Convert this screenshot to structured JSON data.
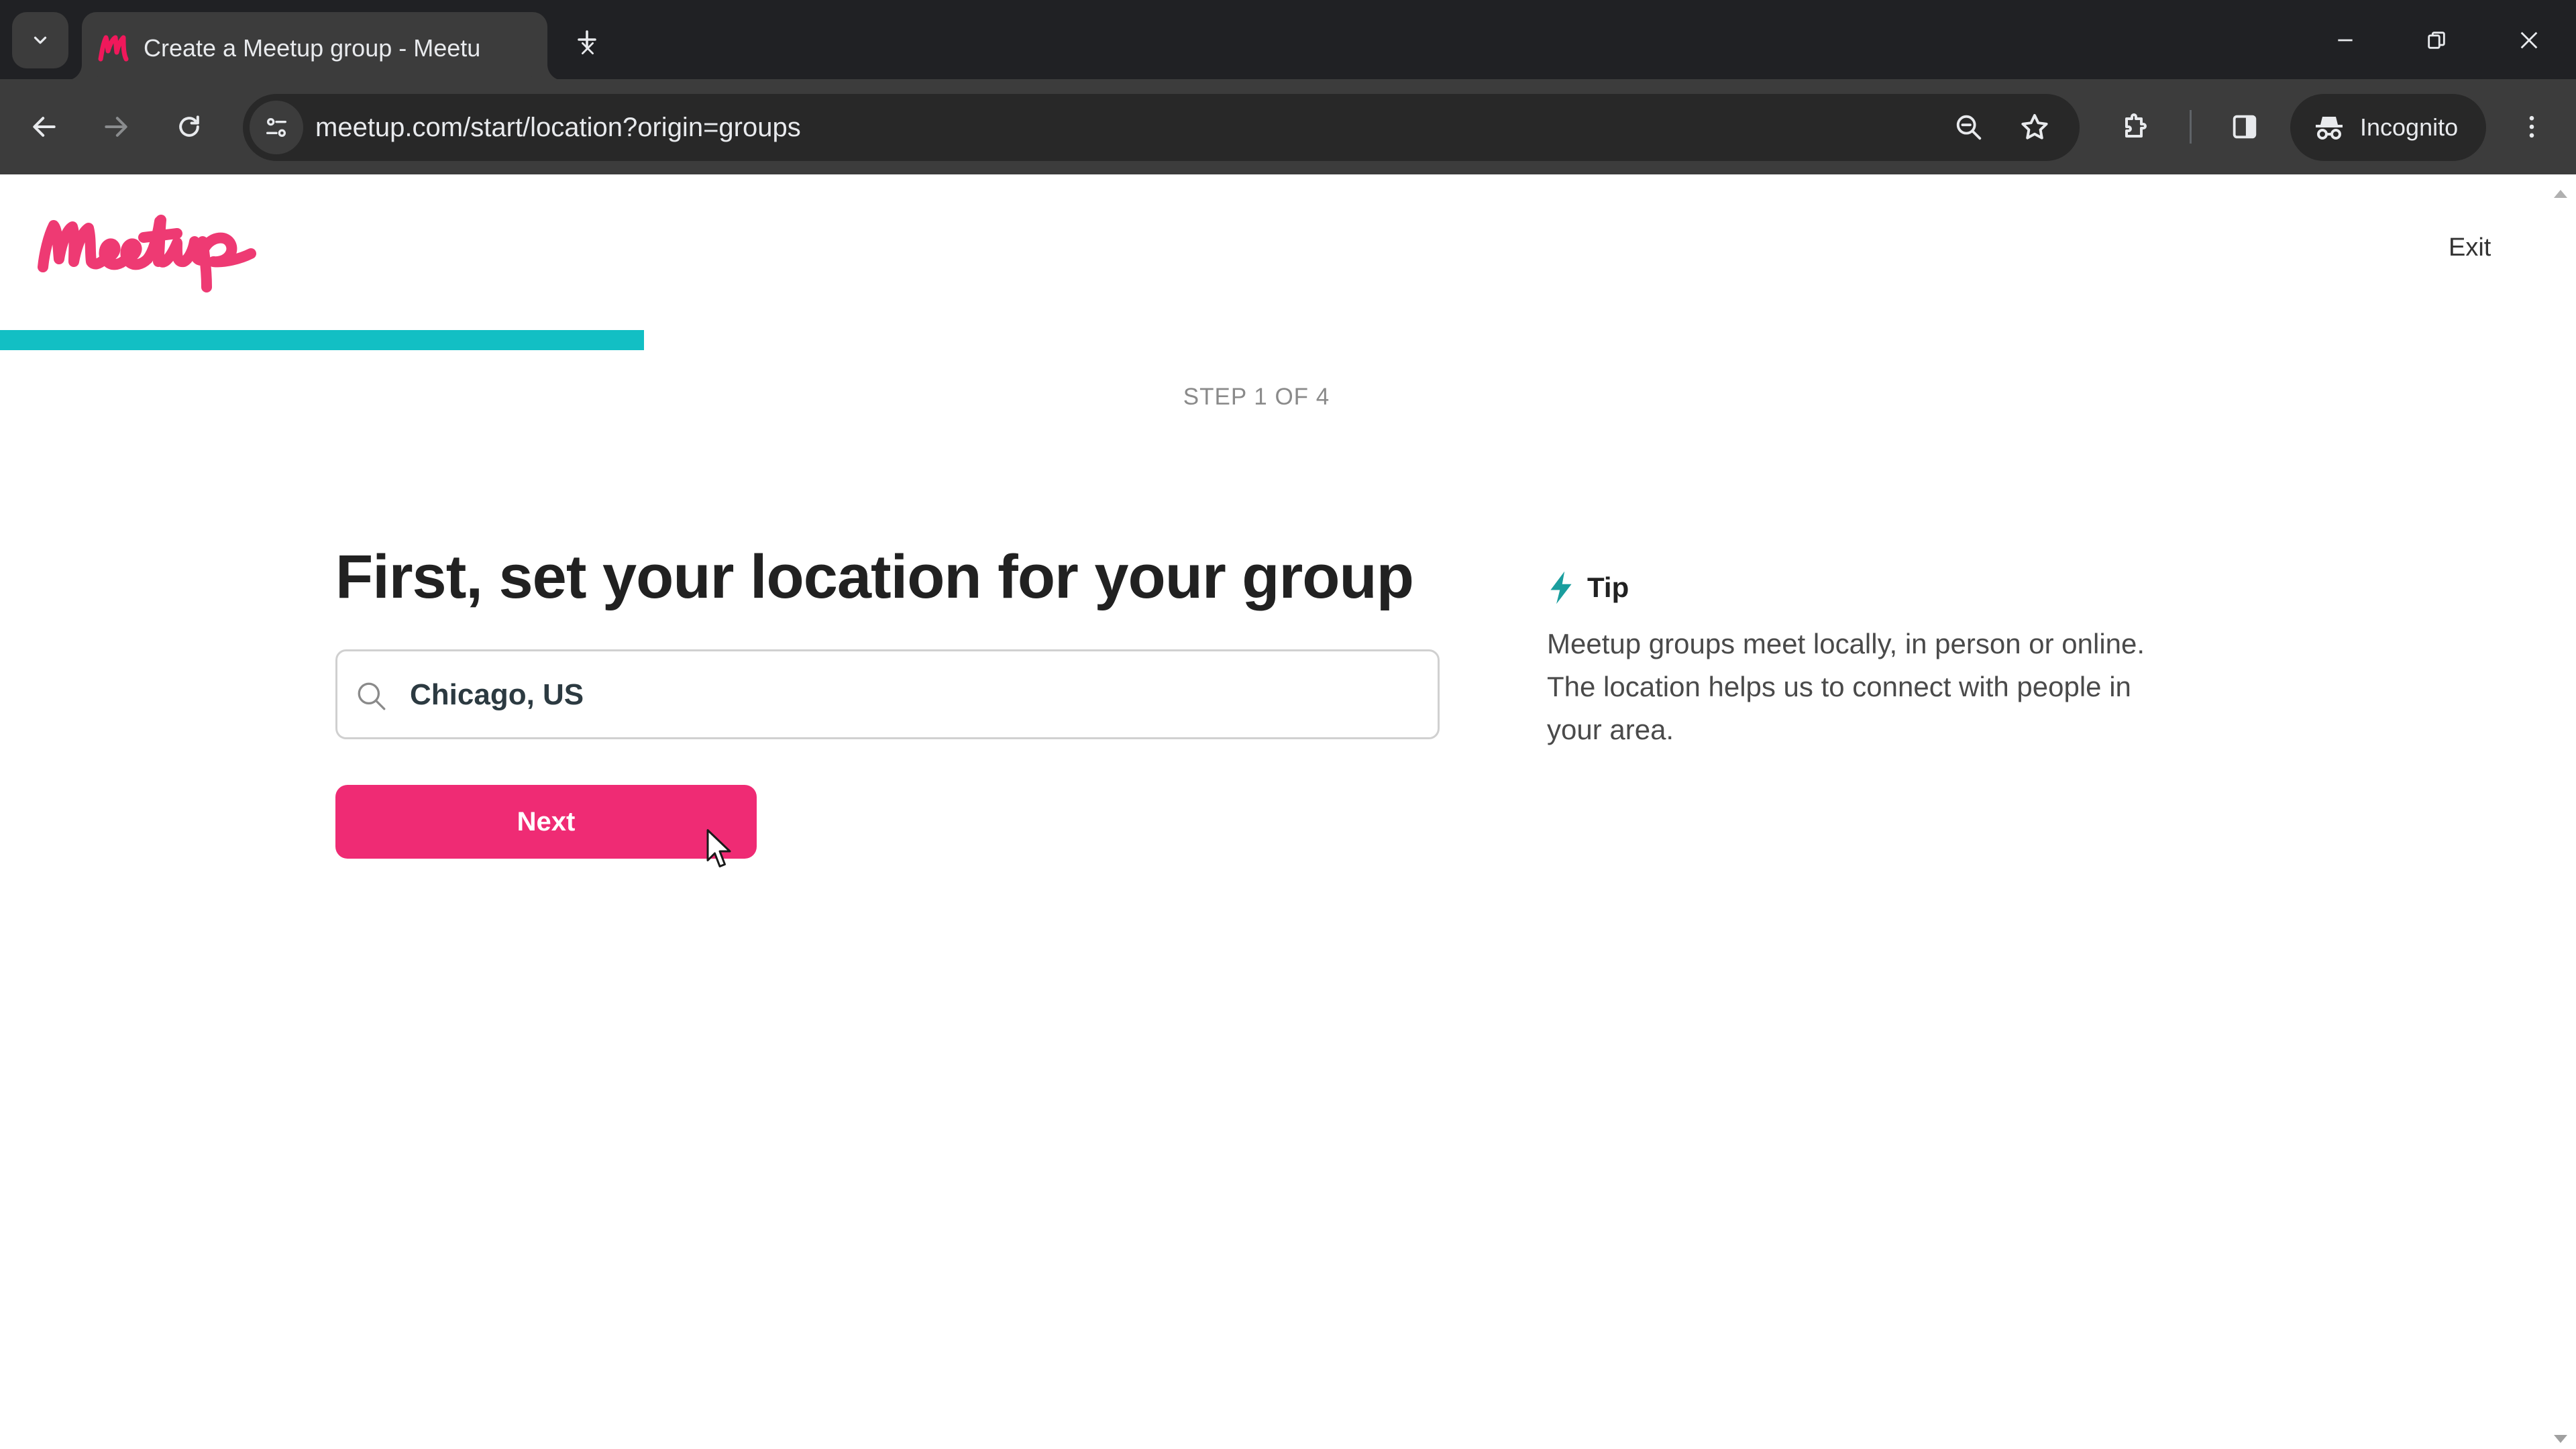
{
  "browser": {
    "tab": {
      "title": "Create a Meetup group - Meetu",
      "favicon": "meetup-favicon"
    },
    "url": "meetup.com/start/location?origin=groups",
    "incognito_label": "Incognito",
    "icons": {
      "tab_search": "chevron-down-icon",
      "tab_close": "close-icon",
      "new_tab": "plus-icon",
      "minimize": "minimize-icon",
      "restore": "restore-icon",
      "close_window": "close-icon",
      "back": "arrow-left-icon",
      "forward": "arrow-right-icon",
      "reload": "reload-icon",
      "site_info": "tune-icon",
      "zoom": "zoom-out-icon",
      "bookmark": "star-icon",
      "extensions": "puzzle-icon",
      "side_panel": "side-panel-icon",
      "incognito": "incognito-icon",
      "menu": "kebab-icon"
    }
  },
  "page": {
    "brand": "Meetup",
    "exit_label": "Exit",
    "progress": {
      "step_label": "STEP 1 OF 4",
      "current_step": 1,
      "total_steps": 4,
      "fraction": 0.25
    },
    "heading": "First, set your location for your group",
    "location_input": {
      "value": "Chicago, US"
    },
    "next_label": "Next",
    "tip": {
      "title": "Tip",
      "body": "Meetup groups meet locally, in person or online. The location helps us to connect with people in your area."
    }
  },
  "colors": {
    "brand_pink": "#ef2b74",
    "progress_teal": "#12bfc4",
    "tip_icon_teal": "#1a9e9e",
    "heading": "#212121"
  }
}
